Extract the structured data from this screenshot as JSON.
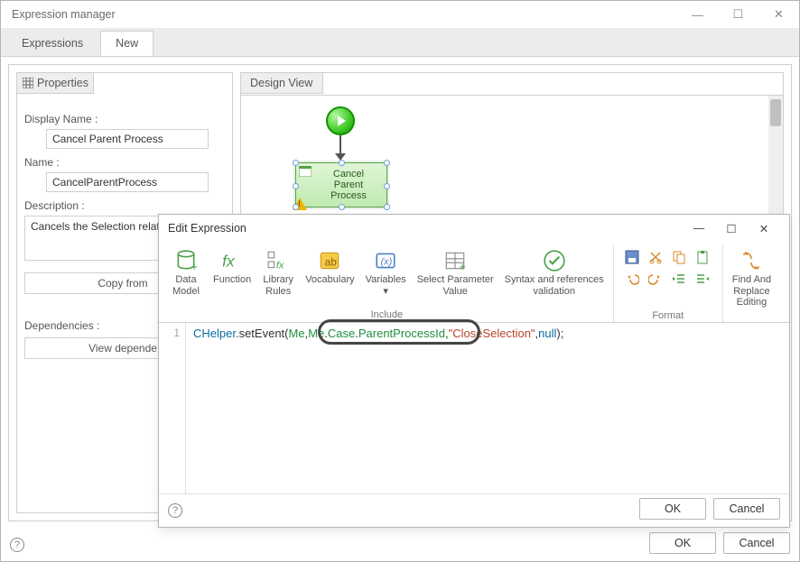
{
  "main": {
    "title": "Expression manager",
    "tabs": [
      "Expressions",
      "New"
    ],
    "active_tab": 1
  },
  "properties": {
    "panel_title": "Properties",
    "display_name_label": "Display Name :",
    "display_name_value": "Cancel Parent Process",
    "name_label": "Name :",
    "name_value": "CancelParentProcess",
    "description_label": "Description :",
    "description_value": "Cancels the Selection related.",
    "copy_from_btn": "Copy from",
    "dependencies_label": "Dependencies :",
    "view_deps_btn": "View depende"
  },
  "design": {
    "panel_title": "Design View",
    "task_label": "Cancel\nParent\nProcess"
  },
  "dialog": {
    "title": "Edit Expression",
    "ribbon": {
      "include_label": "Include",
      "format_label": "Format",
      "items": {
        "data_model": "Data\nModel",
        "function": "Function",
        "library_rules": "Library\nRules",
        "vocabulary": "Vocabulary",
        "variables": "Variables",
        "select_param": "Select Parameter\nValue",
        "syntax": "Syntax and references\nvalidation",
        "find_replace": "Find And\nReplace\nEditing"
      }
    },
    "code": {
      "line_no": "1",
      "s1": "CHelper",
      "s2": ".setEvent(",
      "s3": "Me",
      "s4": ",",
      "s5": "Me",
      "s6": ".",
      "s7": "Case",
      "s8": ".",
      "s9": "ParentProcessId",
      "s10": ",",
      "s11": "\"CloseSelection\"",
      "s12": ",",
      "s13": "null",
      "s14": ");"
    },
    "ok": "OK",
    "cancel": "Cancel"
  },
  "footer": {
    "ok": "OK",
    "cancel": "Cancel"
  }
}
